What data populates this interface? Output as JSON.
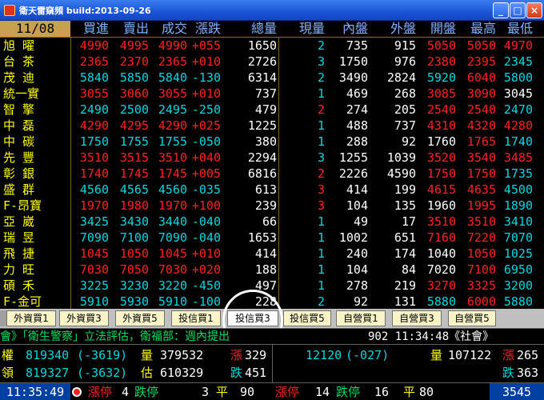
{
  "window": {
    "title": "衛天雷窺頻 build:2013-09-26",
    "min_label": "_",
    "max_label": "□",
    "close_label": "×"
  },
  "table": {
    "date": "11/08",
    "headers": [
      "買進",
      "賣出",
      "成交",
      "漲跌",
      "總量",
      "現量",
      "內盤",
      "外盤",
      "開盤",
      "最高",
      "最低"
    ],
    "rows": [
      {
        "name": "旭  曜",
        "buy": "4990",
        "sell": "4995",
        "deal": "4990",
        "chg": "+055",
        "vol": "1650",
        "cur": "2",
        "in": "735",
        "out": "915",
        "open": "5050",
        "high": "5050",
        "low": "4970",
        "price_color": "red",
        "cur_color": "cyan",
        "open_color": "red",
        "high_color": "red",
        "low_color": "red"
      },
      {
        "name": "台  茶",
        "buy": "2365",
        "sell": "2370",
        "deal": "2365",
        "chg": "+010",
        "vol": "2726",
        "cur": "3",
        "in": "1750",
        "out": "976",
        "open": "2380",
        "high": "2395",
        "low": "2345",
        "price_color": "red",
        "cur_color": "cyan",
        "open_color": "red",
        "high_color": "red",
        "low_color": "cyan"
      },
      {
        "name": "茂  迪",
        "buy": "5840",
        "sell": "5850",
        "deal": "5840",
        "chg": "-130",
        "vol": "6314",
        "cur": "2",
        "in": "3490",
        "out": "2824",
        "open": "5920",
        "high": "6040",
        "low": "5800",
        "price_color": "cyan",
        "cur_color": "cyan",
        "open_color": "cyan",
        "high_color": "red",
        "low_color": "cyan"
      },
      {
        "name": "統一實",
        "buy": "3055",
        "sell": "3060",
        "deal": "3055",
        "chg": "+010",
        "vol": "737",
        "cur": "1",
        "in": "469",
        "out": "268",
        "open": "3085",
        "high": "3090",
        "low": "3045",
        "price_color": "red",
        "cur_color": "cyan",
        "open_color": "red",
        "high_color": "red",
        "low_color": "white"
      },
      {
        "name": "智  擎",
        "buy": "2490",
        "sell": "2500",
        "deal": "2495",
        "chg": "-250",
        "vol": "479",
        "cur": "2",
        "in": "274",
        "out": "205",
        "open": "2540",
        "high": "2540",
        "low": "2470",
        "price_color": "cyan",
        "cur_color": "red",
        "open_color": "red",
        "high_color": "red",
        "low_color": "cyan"
      },
      {
        "name": "中  磊",
        "buy": "4290",
        "sell": "4295",
        "deal": "4290",
        "chg": "+025",
        "vol": "1225",
        "cur": "1",
        "in": "488",
        "out": "737",
        "open": "4310",
        "high": "4320",
        "low": "4280",
        "price_color": "red",
        "cur_color": "cyan",
        "open_color": "red",
        "high_color": "red",
        "low_color": "red"
      },
      {
        "name": "中  碳",
        "buy": "1750",
        "sell": "1755",
        "deal": "1755",
        "chg": "-050",
        "vol": "380",
        "cur": "1",
        "in": "288",
        "out": "92",
        "open": "1760",
        "high": "1765",
        "low": "1740",
        "price_color": "cyan",
        "cur_color": "cyan",
        "open_color": "white",
        "high_color": "red",
        "low_color": "cyan"
      },
      {
        "name": "先  豐",
        "buy": "3510",
        "sell": "3515",
        "deal": "3510",
        "chg": "+040",
        "vol": "2294",
        "cur": "3",
        "in": "1255",
        "out": "1039",
        "open": "3520",
        "high": "3540",
        "low": "3485",
        "price_color": "red",
        "cur_color": "cyan",
        "open_color": "red",
        "high_color": "red",
        "low_color": "red"
      },
      {
        "name": "彰  銀",
        "buy": "1740",
        "sell": "1745",
        "deal": "1745",
        "chg": "+005",
        "vol": "6816",
        "cur": "2",
        "in": "2226",
        "out": "4590",
        "open": "1750",
        "high": "1750",
        "low": "1735",
        "price_color": "red",
        "cur_color": "red",
        "open_color": "red",
        "high_color": "red",
        "low_color": "cyan"
      },
      {
        "name": "盛  群",
        "buy": "4560",
        "sell": "4565",
        "deal": "4560",
        "chg": "-035",
        "vol": "613",
        "cur": "3",
        "in": "414",
        "out": "199",
        "open": "4615",
        "high": "4635",
        "low": "4500",
        "price_color": "cyan",
        "cur_color": "red",
        "open_color": "red",
        "high_color": "red",
        "low_color": "cyan"
      },
      {
        "name": "F-昂寶",
        "buy": "1970",
        "sell": "1980",
        "deal": "1970",
        "chg": "+100",
        "vol": "239",
        "cur": "3",
        "in": "104",
        "out": "135",
        "open": "1960",
        "high": "1995",
        "low": "1890",
        "price_color": "red",
        "cur_color": "red",
        "open_color": "white",
        "high_color": "red",
        "low_color": "cyan"
      },
      {
        "name": "亞  崴",
        "buy": "3425",
        "sell": "3430",
        "deal": "3440",
        "chg": "-040",
        "vol": "66",
        "cur": "1",
        "in": "49",
        "out": "17",
        "open": "3510",
        "high": "3510",
        "low": "3410",
        "price_color": "cyan",
        "cur_color": "cyan",
        "open_color": "red",
        "high_color": "red",
        "low_color": "cyan"
      },
      {
        "name": "瑞  昱",
        "buy": "7090",
        "sell": "7100",
        "deal": "7090",
        "chg": "-040",
        "vol": "1653",
        "cur": "1",
        "in": "1002",
        "out": "651",
        "open": "7160",
        "high": "7220",
        "low": "7070",
        "price_color": "cyan",
        "cur_color": "cyan",
        "open_color": "red",
        "high_color": "red",
        "low_color": "cyan"
      },
      {
        "name": "飛  捷",
        "buy": "1045",
        "sell": "1050",
        "deal": "1045",
        "chg": "+010",
        "vol": "414",
        "cur": "1",
        "in": "240",
        "out": "174",
        "open": "1040",
        "high": "1050",
        "low": "1025",
        "price_color": "red",
        "cur_color": "cyan",
        "open_color": "white",
        "high_color": "red",
        "low_color": "cyan"
      },
      {
        "name": "力  旺",
        "buy": "7030",
        "sell": "7050",
        "deal": "7030",
        "chg": "+020",
        "vol": "188",
        "cur": "1",
        "in": "104",
        "out": "84",
        "open": "7020",
        "high": "7100",
        "low": "6950",
        "price_color": "red",
        "cur_color": "cyan",
        "open_color": "white",
        "high_color": "red",
        "low_color": "cyan"
      },
      {
        "name": "碩  禾",
        "buy": "3225",
        "sell": "3230",
        "deal": "3220",
        "chg": "-450",
        "vol": "497",
        "cur": "1",
        "in": "278",
        "out": "219",
        "open": "3270",
        "high": "3325",
        "low": "3200",
        "price_color": "cyan",
        "cur_color": "cyan",
        "open_color": "red",
        "high_color": "red",
        "low_color": "cyan"
      },
      {
        "name": "F-金可",
        "buy": "5910",
        "sell": "5930",
        "deal": "5910",
        "chg": "-100",
        "vol": "228",
        "cur": "2",
        "in": "92",
        "out": "131",
        "open": "5880",
        "high": "6000",
        "low": "5880",
        "price_color": "cyan",
        "cur_color": "cyan",
        "open_color": "cyan",
        "high_color": "red",
        "low_color": "cyan"
      }
    ]
  },
  "tabs": [
    "外資買1",
    "外資買3",
    "外資買5",
    "投信買1",
    "投信買3",
    "投信買5",
    "自營買1",
    "自營買3",
    "自營買5"
  ],
  "active_tab": 4,
  "ticker": {
    "text": "會》「衛生警察」立法評估，衛福部：週內提出",
    "time": "902 11:34:48《社會》"
  },
  "index": {
    "row1": {
      "label": "權",
      "value": "819340",
      "change": "(-3619)",
      "vol_label": "量",
      "vol": "379532",
      "up_label": "漲",
      "up": "329",
      "r_value": "12120",
      "r_change": "(-027)",
      "r_vol_label": "量",
      "r_vol": "107122",
      "r_up_label": "漲",
      "r_up": "265"
    },
    "row2": {
      "label": "領",
      "value": "819327",
      "change": "(-3632)",
      "est_label": "估",
      "est": "610329",
      "down_label": "跌",
      "down": "451",
      "r_down_label": "跌",
      "r_down": "363"
    }
  },
  "status": {
    "clock": "11:35:49",
    "limit_up": "漲停",
    "limit_up_n": "4",
    "limit_down": "跌停",
    "limit_down_n": "3",
    "flat": "平",
    "flat_n": "90",
    "r_limit_up": "漲停",
    "r_limit_up_n": "14",
    "r_limit_down": "跌停",
    "r_limit_down_n": "16",
    "r_flat": "平",
    "r_flat_n": "80",
    "right_value": "3545"
  }
}
